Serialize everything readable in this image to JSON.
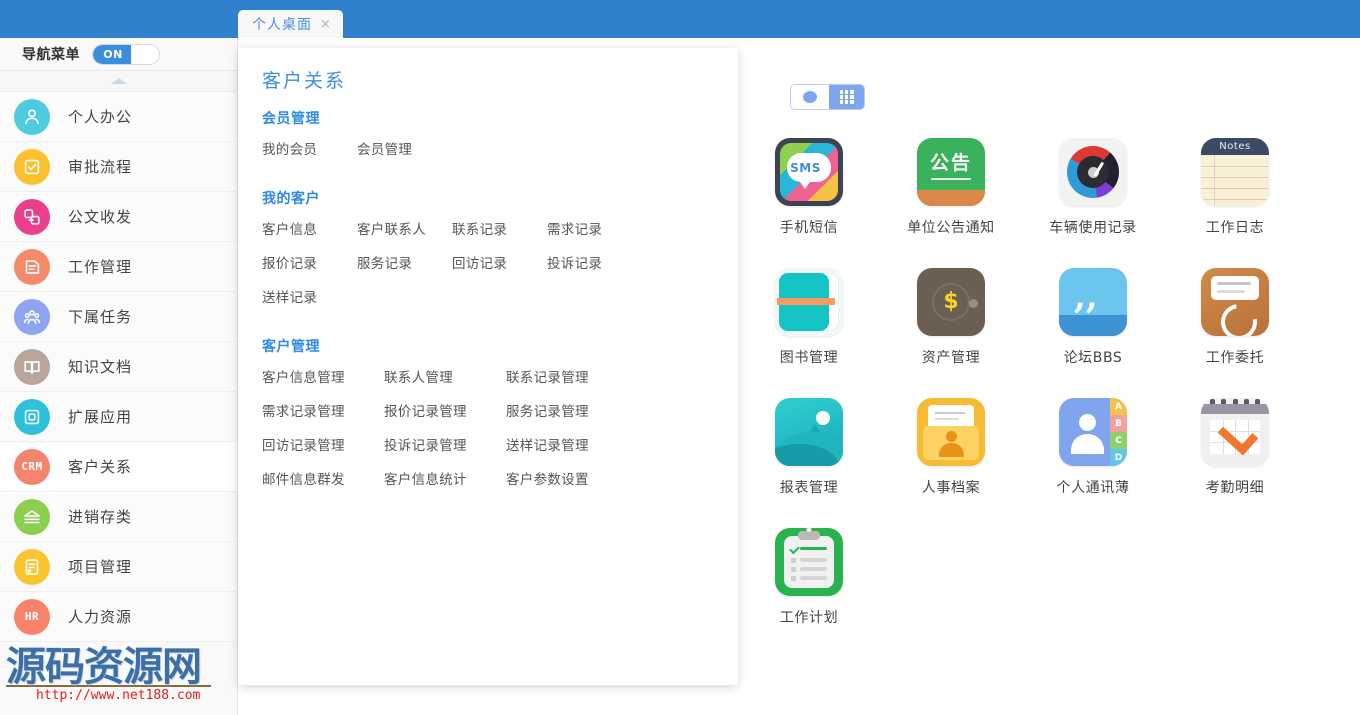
{
  "topbar": {
    "accent_color": "#3080ce",
    "tab": {
      "label": "个人桌面",
      "close": "×"
    }
  },
  "sidebar": {
    "nav_menu_label": "导航菜单",
    "toggle_state": "ON",
    "collapse_icon": "caret-up-icon",
    "items": [
      {
        "label": "个人办公",
        "icon": "user-icon",
        "color": "#4ecbe0",
        "active": false
      },
      {
        "label": "审批流程",
        "icon": "approval-icon",
        "color": "#fbc02d",
        "active": false
      },
      {
        "label": "公文收发",
        "icon": "document-exchange-icon",
        "color": "#ea3f8b",
        "active": false
      },
      {
        "label": "工作管理",
        "icon": "task-icon",
        "color": "#f58a6a",
        "active": false
      },
      {
        "label": "下属任务",
        "icon": "team-icon",
        "color": "#8ea4f0",
        "active": false
      },
      {
        "label": "知识文档",
        "icon": "book-icon",
        "color": "#b9a69a",
        "active": false
      },
      {
        "label": "扩展应用",
        "icon": "extension-icon",
        "color": "#2ec1dd",
        "active": false
      },
      {
        "label": "客户关系",
        "icon": "crm-icon",
        "color": "#f4846b",
        "text": "CRM",
        "active": true
      },
      {
        "label": "进销存类",
        "icon": "inventory-icon",
        "color": "#8ccf4e",
        "active": false
      },
      {
        "label": "项目管理",
        "icon": "project-icon",
        "color": "#f7c631",
        "active": false
      },
      {
        "label": "人力资源",
        "icon": "hr-icon",
        "color": "#f9836a",
        "text": "HR",
        "active": false
      }
    ]
  },
  "watermark": {
    "text": "源码资源网",
    "url": "http://www.net188.com"
  },
  "megapanel": {
    "title": "客户关系",
    "groups": [
      {
        "title": "会员管理",
        "wide": false,
        "links": [
          "我的会员",
          "会员管理"
        ]
      },
      {
        "title": "我的客户",
        "wide": false,
        "links": [
          "客户信息",
          "客户联系人",
          "联系记录",
          "需求记录",
          "报价记录",
          "服务记录",
          "回访记录",
          "投诉记录",
          "送样记录"
        ]
      },
      {
        "title": "客户管理",
        "wide": true,
        "links": [
          "客户信息管理",
          "联系人管理",
          "联系记录管理",
          "需求记录管理",
          "报价记录管理",
          "服务记录管理",
          "回访记录管理",
          "投诉记录管理",
          "送样记录管理",
          "邮件信息群发",
          "客户信息统计",
          "客户参数设置"
        ]
      }
    ]
  },
  "main": {
    "view_toggle": {
      "list_icon": "circle-icon",
      "grid_icon": "grid-icon",
      "selected": "grid"
    },
    "apps": [
      {
        "label": "手机短信",
        "icon": "sms-icon"
      },
      {
        "label": "单位公告通知",
        "icon": "notice-icon"
      },
      {
        "label": "车辆使用记录",
        "icon": "gauge-icon"
      },
      {
        "label": "工作日志",
        "icon": "notes-icon",
        "badge": "Notes"
      },
      {
        "label": "图书管理",
        "icon": "book-icon"
      },
      {
        "label": "资产管理",
        "icon": "wallet-icon"
      },
      {
        "label": "论坛BBS",
        "icon": "quote-bubble-icon"
      },
      {
        "label": "工作委托",
        "icon": "entrust-icon"
      },
      {
        "label": "报表管理",
        "icon": "report-chart-icon"
      },
      {
        "label": "人事档案",
        "icon": "personnel-file-icon"
      },
      {
        "label": "个人通讯薄",
        "icon": "contacts-icon",
        "tabs": [
          "A",
          "B",
          "C",
          "D"
        ]
      },
      {
        "label": "考勤明细",
        "icon": "attendance-calendar-icon"
      },
      {
        "label": "工作计划",
        "icon": "clipboard-plan-icon"
      }
    ]
  }
}
